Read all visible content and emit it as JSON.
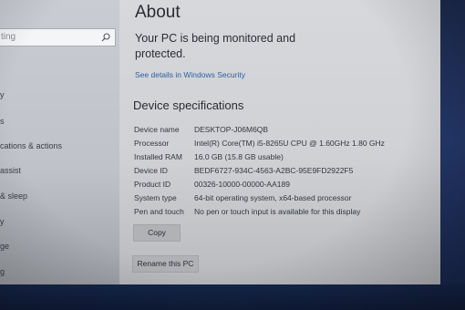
{
  "sidebar": {
    "search_placeholder": "ting",
    "items": [
      {
        "label": "y"
      },
      {
        "label": "s"
      },
      {
        "label": "cations & actions"
      },
      {
        "label": "assist"
      },
      {
        "label": "& sleep"
      },
      {
        "label": "y"
      },
      {
        "label": "ge"
      },
      {
        "label": "g"
      }
    ]
  },
  "main": {
    "title": "About",
    "monitor_status": "Your PC is being monitored and protected.",
    "security_link": "See details in Windows Security",
    "device_heading": "Device specifications",
    "specs": [
      {
        "label": "Device name",
        "value": "DESKTOP-J06M6QB"
      },
      {
        "label": "Processor",
        "value": "Intel(R) Core(TM) i5-8265U CPU @ 1.60GHz   1.80 GHz"
      },
      {
        "label": "Installed RAM",
        "value": "16.0 GB (15.8 GB usable)"
      },
      {
        "label": "Device ID",
        "value": "BEDF6727-934C-4563-A2BC-95E9FD2922F5"
      },
      {
        "label": "Product ID",
        "value": "00326-10000-00000-AA189"
      },
      {
        "label": "System type",
        "value": "64-bit operating system, x64-based processor"
      },
      {
        "label": "Pen and touch",
        "value": "No pen or touch input is available for this display"
      }
    ],
    "copy_label": "Copy",
    "rename_label": "Rename this PC"
  }
}
